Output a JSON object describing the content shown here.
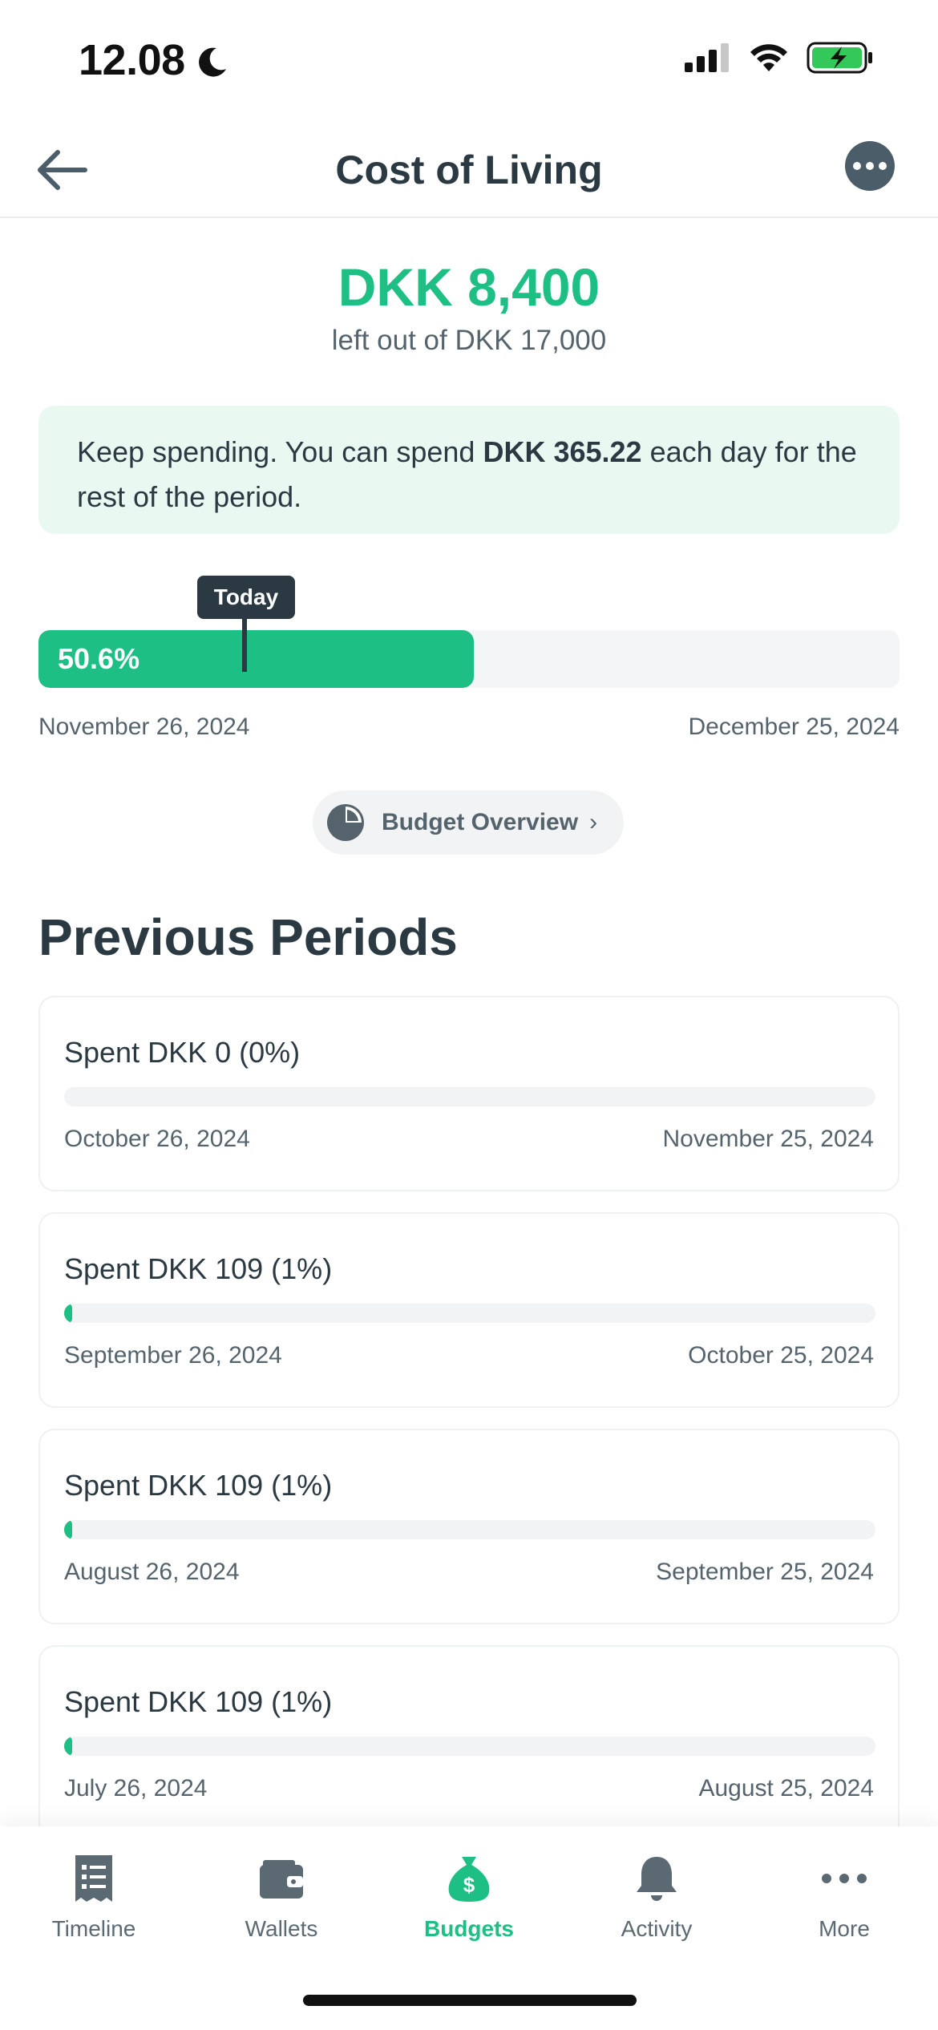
{
  "status_bar": {
    "time": "12.08"
  },
  "header": {
    "title": "Cost of Living"
  },
  "summary": {
    "amount_left": "DKK 8,400",
    "subtitle": "left out of DKK 17,000"
  },
  "advice": {
    "prefix": "Keep spending. You can spend ",
    "amount": "DKK 365.22",
    "suffix": " each day for the rest of the period."
  },
  "current_period": {
    "today_label": "Today",
    "progress_label": "50.6%",
    "progress_fraction": 0.506,
    "start_date": "November 26, 2024",
    "end_date": "December 25, 2024"
  },
  "overview_button": {
    "label": "Budget Overview"
  },
  "previous_periods": {
    "title": "Previous Periods",
    "items": [
      {
        "spent": "Spent DKK 0 (0%)",
        "fraction": 0.0,
        "start": "October 26, 2024",
        "end": "November 25, 2024"
      },
      {
        "spent": "Spent DKK 109 (1%)",
        "fraction": 0.01,
        "start": "September 26, 2024",
        "end": "October 25, 2024"
      },
      {
        "spent": "Spent DKK 109 (1%)",
        "fraction": 0.01,
        "start": "August 26, 2024",
        "end": "September 25, 2024"
      },
      {
        "spent": "Spent DKK 109 (1%)",
        "fraction": 0.01,
        "start": "July 26, 2024",
        "end": "August 25, 2024"
      }
    ]
  },
  "tabbar": {
    "items": [
      {
        "label": "Timeline",
        "icon": "receipt-icon"
      },
      {
        "label": "Wallets",
        "icon": "wallet-icon"
      },
      {
        "label": "Budgets",
        "icon": "money-bag-icon",
        "active": true
      },
      {
        "label": "Activity",
        "icon": "bell-icon"
      },
      {
        "label": "More",
        "icon": "more-dots-icon"
      }
    ]
  },
  "colors": {
    "accent": "#1dbf84",
    "dark": "#2b3a42",
    "muted": "#55646c"
  }
}
